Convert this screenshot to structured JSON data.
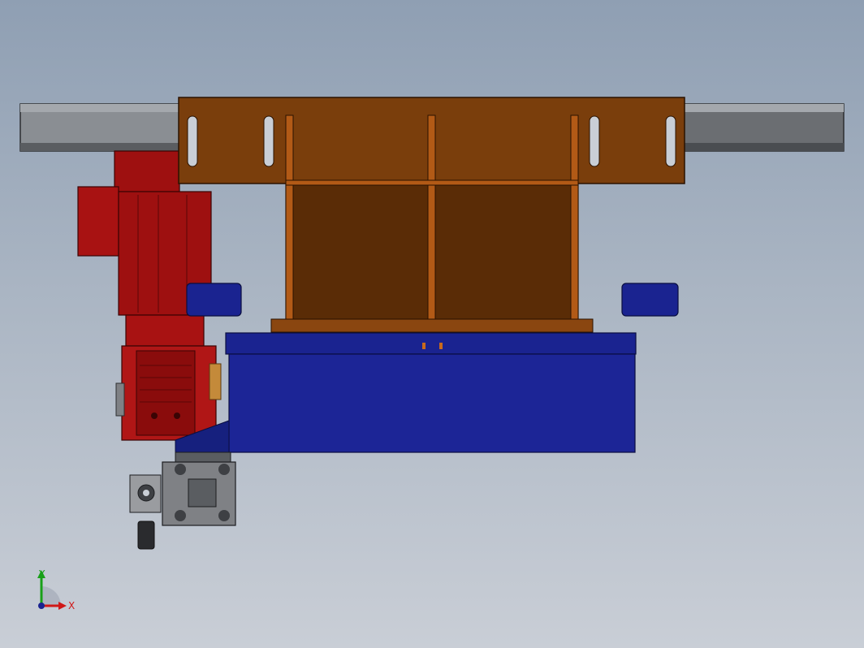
{
  "view": {
    "background_top": "#8f9fb3",
    "background_bottom": "#c9ced6"
  },
  "colors": {
    "rail": "#8a8e93",
    "rail_dark": "#5a5d61",
    "bracket_plate": "#7a3e0c",
    "bracket_frame": "#5a2c06",
    "bracket_highlight": "#c86a1c",
    "motor": "#9e1010",
    "motor_dark": "#6e0808",
    "body": "#1a2390",
    "body_dark": "#0c1260",
    "steel": "#7f8185",
    "steel_dark": "#3e4044"
  },
  "triad": {
    "x_label": "X",
    "y_label": "Y",
    "x_color": "#d01818",
    "y_color": "#18a018",
    "z_color": "#1a2390"
  }
}
